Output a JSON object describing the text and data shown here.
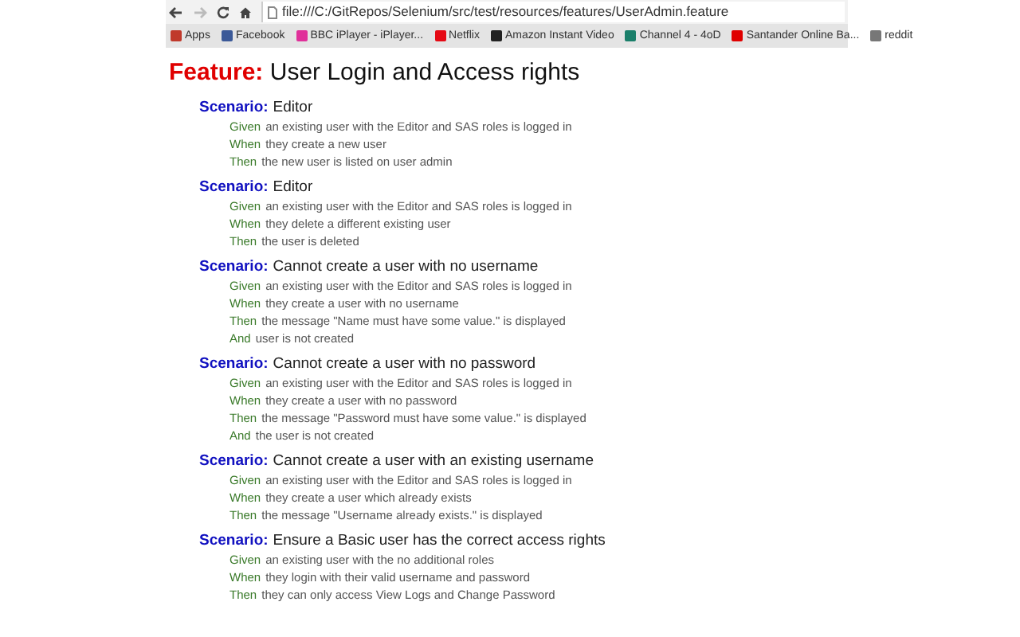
{
  "browser": {
    "url": "file:///C:/GitRepos/Selenium/src/test/resources/features/UserAdmin.feature",
    "bookmarks": [
      {
        "label": "Apps",
        "color": "#c0392b"
      },
      {
        "label": "Facebook",
        "color": "#3b5998"
      },
      {
        "label": "BBC iPlayer - iPlayer...",
        "color": "#e0309a"
      },
      {
        "label": "Netflix",
        "color": "#e50914"
      },
      {
        "label": "Amazon Instant Video",
        "color": "#222222"
      },
      {
        "label": "Channel 4 - 4oD",
        "color": "#1a7f6a"
      },
      {
        "label": "Santander Online Ba...",
        "color": "#e00000"
      },
      {
        "label": "reddit",
        "color": "#777777"
      }
    ]
  },
  "feature": {
    "keyword": "Feature:",
    "title": "User Login and Access rights"
  },
  "scenarios": [
    {
      "keyword": "Scenario:",
      "title": "Editor",
      "steps": [
        {
          "keyword": "Given",
          "text": "an existing user with the Editor and SAS roles is logged in"
        },
        {
          "keyword": "When",
          "text": "they create a new user"
        },
        {
          "keyword": "Then",
          "text": "the new user is listed on user admin"
        }
      ]
    },
    {
      "keyword": "Scenario:",
      "title": "Editor",
      "steps": [
        {
          "keyword": "Given",
          "text": "an existing user with the Editor and SAS roles is logged in"
        },
        {
          "keyword": "When",
          "text": "they delete a different existing user"
        },
        {
          "keyword": "Then",
          "text": "the user is deleted"
        }
      ]
    },
    {
      "keyword": "Scenario:",
      "title": "Cannot create a user with no username",
      "steps": [
        {
          "keyword": "Given",
          "text": "an existing user with the Editor and SAS roles is logged in"
        },
        {
          "keyword": "When",
          "text": "they create a user with no username"
        },
        {
          "keyword": "Then",
          "text": "the message \"Name must have some value.\" is displayed"
        },
        {
          "keyword": "And",
          "text": "user is not created"
        }
      ]
    },
    {
      "keyword": "Scenario:",
      "title": "Cannot create a user with no password",
      "steps": [
        {
          "keyword": "Given",
          "text": "an existing user with the Editor and SAS roles is logged in"
        },
        {
          "keyword": "When",
          "text": "they create a user with no password"
        },
        {
          "keyword": "Then",
          "text": "the message \"Password must have some value.\" is displayed"
        },
        {
          "keyword": "And",
          "text": "the user is not created"
        }
      ]
    },
    {
      "keyword": "Scenario:",
      "title": "Cannot create a user with an existing username",
      "steps": [
        {
          "keyword": "Given",
          "text": "an existing user with the Editor and SAS roles is logged in"
        },
        {
          "keyword": "When",
          "text": "they create a user which already exists"
        },
        {
          "keyword": "Then",
          "text": "the message \"Username already exists.\" is displayed"
        }
      ]
    },
    {
      "keyword": "Scenario:",
      "title": "Ensure a Basic user has the correct access rights",
      "steps": [
        {
          "keyword": "Given",
          "text": "an existing user with the no additional roles"
        },
        {
          "keyword": "When",
          "text": "they login with their valid username and password"
        },
        {
          "keyword": "Then",
          "text": "they can only access View Logs and Change Password"
        }
      ]
    }
  ]
}
